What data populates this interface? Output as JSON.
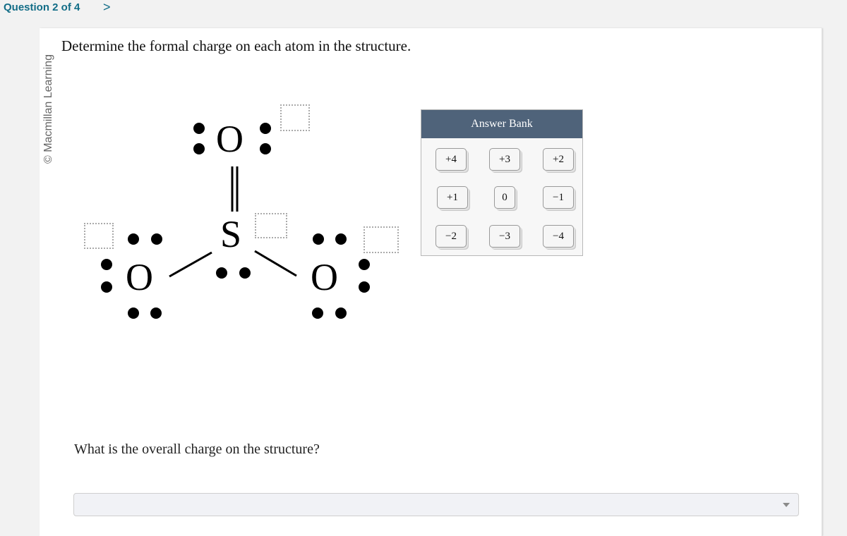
{
  "nav": {
    "question_label": "Question 2 of 4",
    "next_icon": "chevron-right-icon",
    "next_glyph": ">"
  },
  "sidebar": {
    "copyright": "© Macmillan Learning"
  },
  "question": {
    "prompt": "Determine the formal charge on each atom in the structure.",
    "structure": {
      "atoms": [
        {
          "id": "top-oxygen",
          "symbol": "O"
        },
        {
          "id": "sulfur",
          "symbol": "S"
        },
        {
          "id": "left-oxygen",
          "symbol": "O"
        },
        {
          "id": "right-oxygen",
          "symbol": "O"
        }
      ],
      "bonds": [
        {
          "from": "sulfur",
          "to": "top-oxygen",
          "order": 2
        },
        {
          "from": "sulfur",
          "to": "left-oxygen",
          "order": 1
        },
        {
          "from": "sulfur",
          "to": "right-oxygen",
          "order": 1
        }
      ],
      "lone_pairs": {
        "top-oxygen": 2,
        "sulfur": 1,
        "left-oxygen": 3,
        "right-oxygen": 3
      },
      "charge_targets": [
        "top-oxygen",
        "sulfur",
        "left-oxygen",
        "right-oxygen"
      ]
    },
    "followup": "What is the overall charge on the structure?",
    "overall_charge_select": {
      "selected": ""
    }
  },
  "answer_bank": {
    "title": "Answer Bank",
    "options": [
      "+4",
      "+3",
      "+2",
      "+1",
      "0",
      "−1",
      "−2",
      "−3",
      "−4"
    ]
  }
}
